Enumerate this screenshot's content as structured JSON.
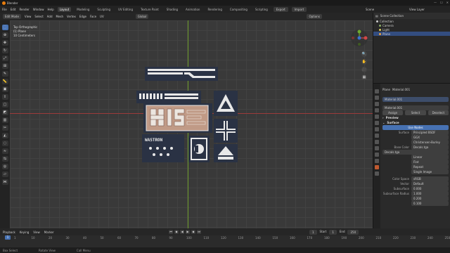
{
  "app": {
    "title": "Blender",
    "window_buttons": [
      "—",
      "☐",
      "✕"
    ]
  },
  "menubar": {
    "menus": [
      "File",
      "Edit",
      "Render",
      "Window",
      "Help"
    ],
    "workspaces": [
      "Layout",
      "Modeling",
      "Sculpting",
      "UV Editing",
      "Texture Paint",
      "Shading",
      "Animation",
      "Rendering",
      "Compositing",
      "Scripting"
    ],
    "export_label": "Export",
    "import_label": "Import",
    "scene_label": "Scene",
    "view_layer_label": "View Layer"
  },
  "viewport_header": {
    "mode": "Edit Mode",
    "view": "View",
    "select": "Select",
    "add": "Add",
    "mesh": "Mesh",
    "vertex": "Vertex",
    "edge": "Edge",
    "face": "Face",
    "uv": "UV",
    "orientation": "Global",
    "options": "Options"
  },
  "viewport": {
    "info_line1": "Top Orthographic",
    "info_line2": "(1) Plane",
    "info_line3": "10 Centimeters"
  },
  "decals": {
    "text_label": "WASTRON"
  },
  "outliner": {
    "title": "Scene Collection",
    "items": [
      {
        "label": "Collection",
        "icon": "collection-icon",
        "selected": false
      },
      {
        "label": "Camera",
        "icon": "camera-icon",
        "selected": false
      },
      {
        "label": "Light",
        "icon": "light-icon",
        "selected": false
      },
      {
        "label": "Plane",
        "icon": "mesh-icon",
        "selected": true
      }
    ]
  },
  "properties": {
    "object_name": "Plane",
    "material_name": "Material.001",
    "slot_label": "Material.001",
    "material_field": "Material.001",
    "buttons": [
      "Assign",
      "Select",
      "Deselect"
    ],
    "preview_label": "Preview",
    "surface_label": "Surface",
    "use_nodes_label": "Use Nodes",
    "surface_shader": "Principled BSDF",
    "distribution": "GGX",
    "subsurface_method": "Christensen-Burley",
    "base_color_label": "Base Color",
    "base_color_value": "Decals.tga",
    "image_name": "Decals.tga",
    "interpolation": "Linear",
    "projection": "Flat",
    "extension": "Repeat",
    "source": "Single Image",
    "color_space_label": "Color Space",
    "color_space": "sRGB",
    "vector_label": "Vector",
    "vector_value": "Default",
    "subsurface_label": "Subsurface",
    "subsurface_value": "0.000",
    "subsurface_radius_label": "Subsurface Radius",
    "radius_values": [
      "1.000",
      "0.200",
      "0.100"
    ],
    "surface_row_label": "Surface"
  },
  "timeline": {
    "menus": [
      "Playback",
      "Keying",
      "View",
      "Marker"
    ],
    "current_frame": "1",
    "start_label": "Start",
    "start": "1",
    "end_label": "End",
    "end": "250",
    "frames": [
      "1",
      "10",
      "20",
      "30",
      "40",
      "50",
      "60",
      "70",
      "80",
      "90",
      "100",
      "110",
      "120",
      "130",
      "140",
      "150",
      "160",
      "170",
      "180",
      "190",
      "200",
      "210",
      "220",
      "230",
      "240",
      "250"
    ]
  },
  "statusbar": {
    "select": "Box Select",
    "rotate": "Rotate View",
    "context": "Call Menu"
  },
  "colors": {
    "accent": "#4772b3",
    "decal_bg": "#2a3244",
    "decal_fg": "#e8e8e8",
    "decal_tan": "#c09a86"
  }
}
